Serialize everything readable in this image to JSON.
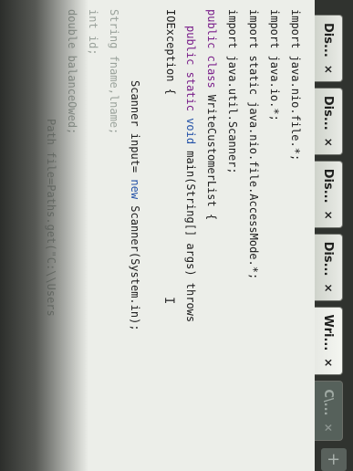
{
  "tabs": [
    {
      "label": "Dis...",
      "close": "×",
      "active": false,
      "dim": false
    },
    {
      "label": "Dis...",
      "close": "×",
      "active": false,
      "dim": false
    },
    {
      "label": "Dis...",
      "close": "×",
      "active": false,
      "dim": false
    },
    {
      "label": "Dis...",
      "close": "×",
      "active": false,
      "dim": false
    },
    {
      "label": "Wri...",
      "close": "×",
      "active": true,
      "dim": false
    },
    {
      "label": "C\\...",
      "close": "×",
      "active": false,
      "dim": true
    }
  ],
  "new_tab_label": "+",
  "code": {
    "line1": "import java.nio.file.*;",
    "line2": "import java.io.*;",
    "line3a": "import static java.nio.file.AccessMode.*;",
    "line4": "import java.util.Scanner;",
    "line5_kw": "public class",
    "line5_rest": " WriteCustomerList {",
    "line6_kw": "public static",
    "line6_ty": " void",
    "line6_rest": " main(String[] args) throws",
    "line7": "IOException {",
    "line8_pre": "Scanner input= ",
    "line8_kw": "new",
    "line8_rest": " Scanner(System.in);",
    "line9": "String fname,lname;",
    "line10": "int id;",
    "line11": "double balanceOwed;",
    "line12": "Path file=Paths.get(\"C:\\\\Users"
  },
  "colors": {
    "keyword": "#7a1f8a",
    "type": "#2452a8",
    "editor_bg": "#eceee9",
    "tabbar_bg": "#30332f"
  }
}
